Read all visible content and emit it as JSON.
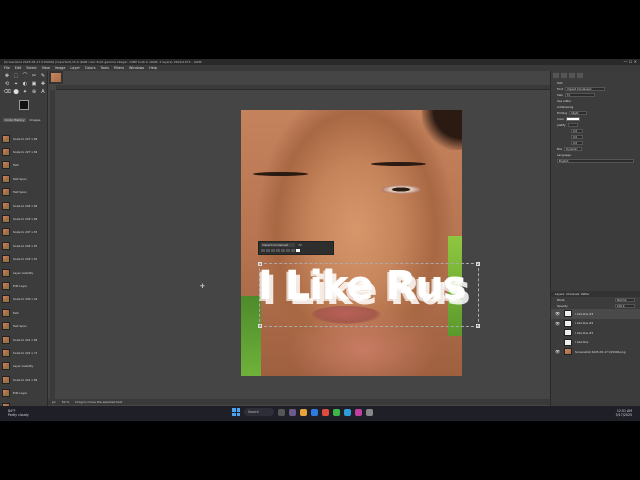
{
  "window": {
    "title": "[Screenshot 2025-05-17 015006] (imported)-15.0 (RGB color 8-bit gamma integer, GIMP built-in sRGB, 2 layers) 1904x1573 – GIMP",
    "controls": "— ☐ ✕"
  },
  "menu": [
    "File",
    "Edit",
    "Select",
    "View",
    "Image",
    "Layer",
    "Colors",
    "Tools",
    "Filters",
    "Windows",
    "Help"
  ],
  "toolbox": {
    "tools": [
      "✥",
      "⬚",
      "⌒",
      "✂",
      "✎",
      "⟲",
      "⌖",
      "◐",
      "▣",
      "✚",
      "⌫",
      "⬤",
      "✦",
      "⊕",
      "A"
    ],
    "history_tabs": [
      "Undo History",
      "Images"
    ],
    "history": [
      "Scale to 227 x 66",
      "Scale to 227 x 66",
      "Text",
      "Text Span",
      "Text Span",
      "Scale to 243 x 66",
      "Scale to 243 x 66",
      "Scale to 247 x 67",
      "Scale to 243 x 67",
      "Scale to 243 x 67",
      "Layer visibility",
      "Edit Layer",
      "Scale to 330 x 91",
      "Text",
      "Text Span",
      "Scale to 222 x 66",
      "Scale to 222 x 71",
      "Layer visibility",
      "Scale to 222 x 89",
      "Edit Layer",
      "Text"
    ]
  },
  "canvas": {
    "text_layers": [
      "I Like Rus",
      "I Like Rus",
      "I Like Rus"
    ],
    "text_toolbar": {
      "font": "Impact Condensed",
      "size": "72"
    }
  },
  "status": {
    "unit": "px",
    "zoom": "50 %",
    "message": "Drag to move the selected text"
  },
  "dock": {
    "tool_name": "Text",
    "font_label": "Font",
    "font_value": "Impact Condensed",
    "size_label": "Size",
    "size_value": "72",
    "options": [
      "Use editor",
      "Antialiasing"
    ],
    "hinting_label": "Hinting",
    "hinting_value": "Slight",
    "color_label": "Color",
    "justify_label": "Justify",
    "indent_value": "0.0",
    "line_spacing_value": "0.0",
    "letter_spacing_value": "0.0",
    "box_label": "Box",
    "box_value": "Dynamic",
    "language_label": "Language",
    "language_value": "English"
  },
  "layers": {
    "tabs": [
      "Layers",
      "Channels",
      "Paths"
    ],
    "mode_label": "Mode",
    "mode_value": "Normal",
    "opacity_label": "Opacity",
    "opacity_value": "100.0",
    "items": [
      {
        "name": "I Like Rus #3",
        "kind": "text"
      },
      {
        "name": "I Like Rus #2",
        "kind": "text"
      },
      {
        "name": "I Like Rus #1",
        "kind": "text"
      },
      {
        "name": "I Like Rus",
        "kind": "text"
      },
      {
        "name": "Screenshot 2025-05-17 015006.png",
        "kind": "image"
      }
    ]
  },
  "taskbar": {
    "weather_temp": "84°F",
    "weather_desc": "Partly cloudy",
    "search_label": "Search",
    "time": "12:51 AM",
    "date": "5/17/2025"
  }
}
